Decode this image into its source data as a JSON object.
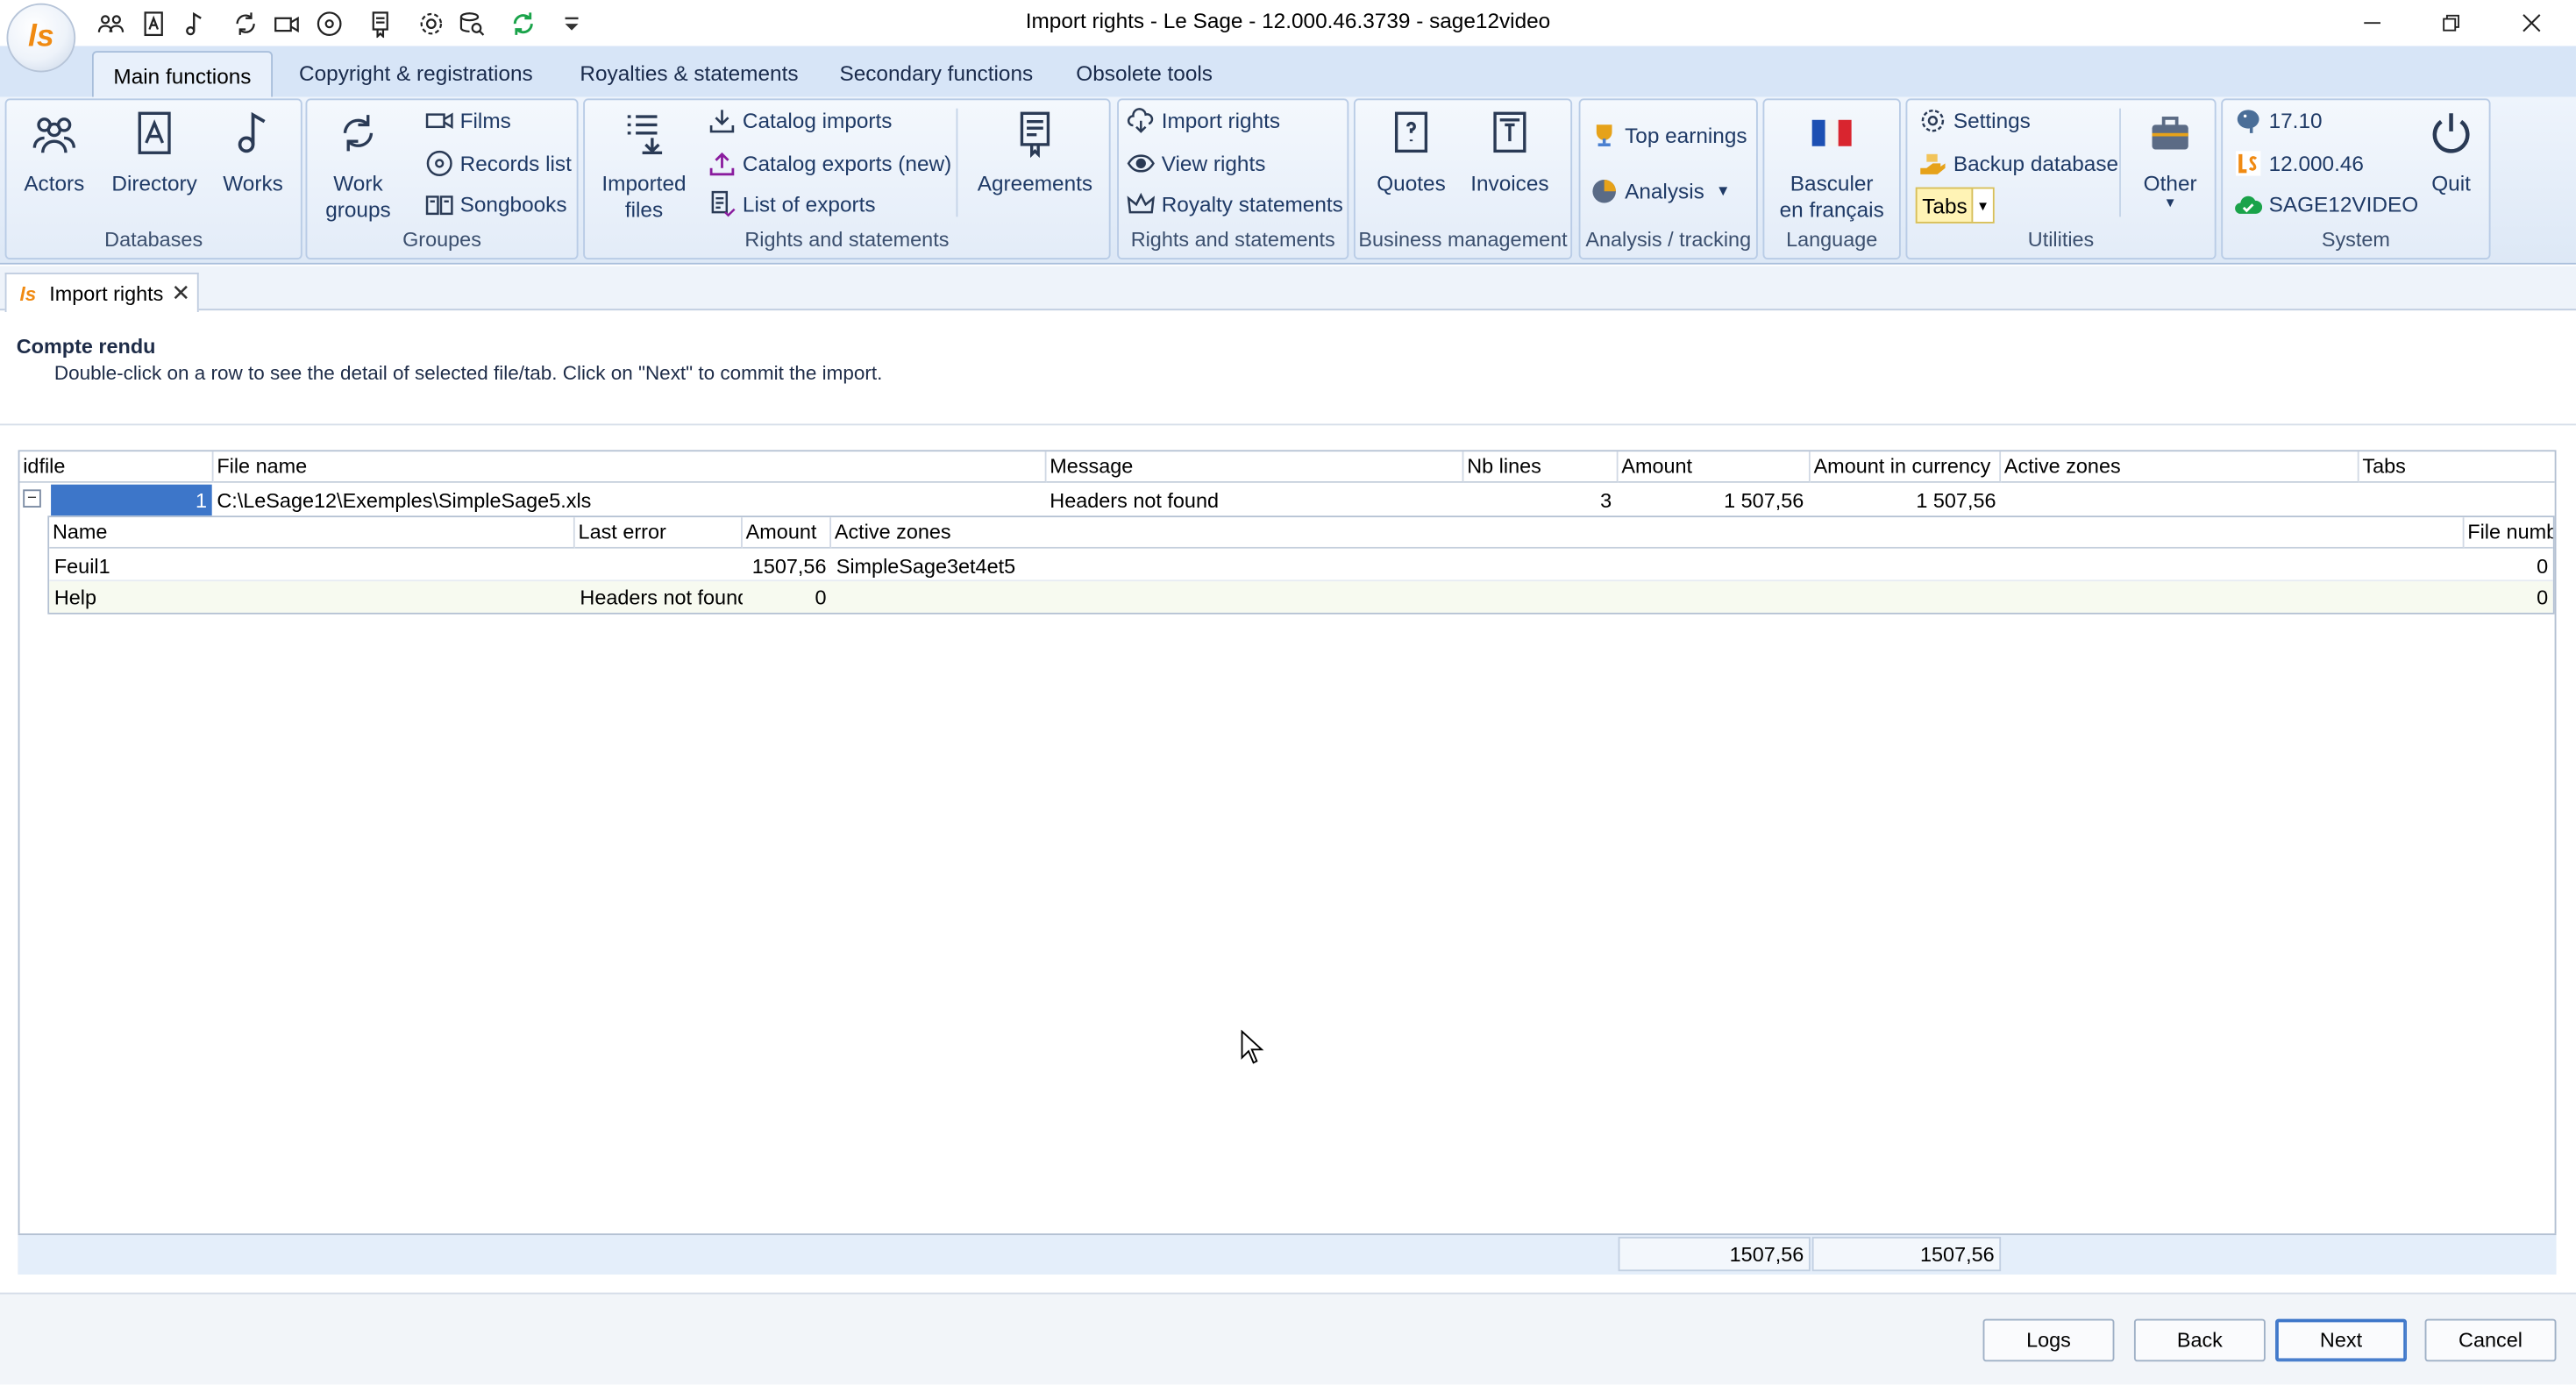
{
  "window": {
    "title": "Import rights - Le Sage - 12.000.46.3739  - sage12video",
    "logo_text": "ls"
  },
  "quick_access": [
    "people-icon",
    "contact-card-icon",
    "music-note-icon",
    "refresh-cycle-icon",
    "video-camera-icon",
    "disc-icon",
    "bookmark-icon",
    "gear-icon",
    "search-database-icon",
    "sync-icon",
    "dropdown-arrow-icon"
  ],
  "ribbon_tabs": [
    "Main functions",
    "Copyright & registrations",
    "Royalties & statements",
    "Secondary functions",
    "Obsolete tools"
  ],
  "ribbon": {
    "databases": {
      "label": "Databases",
      "actors": "Actors",
      "directory": "Directory",
      "works": "Works"
    },
    "groupes": {
      "label": "Groupes",
      "work_groups_1": "Work",
      "work_groups_2": "groups",
      "films": "Films",
      "records_list": "Records list",
      "songbooks": "Songbooks"
    },
    "rights1": {
      "label": "Rights and statements",
      "imported_1": "Imported",
      "imported_2": "files",
      "catalog_imports": "Catalog imports",
      "catalog_exports": "Catalog exports (new)",
      "list_exports": "List of exports",
      "agreements": "Agreements"
    },
    "rights2": {
      "label": "Rights and statements",
      "import_rights": "Import rights",
      "view_rights": "View rights",
      "royalty_statements": "Royalty statements"
    },
    "business": {
      "label": "Business management",
      "quotes": "Quotes",
      "invoices": "Invoices"
    },
    "analysis": {
      "label": "Analysis / tracking",
      "top_earnings": "Top earnings",
      "analysis": "Analysis"
    },
    "language": {
      "label": "Language",
      "basculer_1": "Basculer",
      "basculer_2": "en français"
    },
    "utilities": {
      "label": "Utilities",
      "settings": "Settings",
      "backup": "Backup database",
      "tabs": "Tabs",
      "other": "Other"
    },
    "system": {
      "label": "System",
      "pg_version": "17.10",
      "app_version": "12.000.46",
      "db_name": "SAGE12VIDEO",
      "quit": "Quit"
    }
  },
  "doc_tab": {
    "label": "Import rights"
  },
  "report": {
    "heading": "Compte rendu",
    "instructions": "Double-click on a row to see the detail of selected file/tab. Click on \"Next\" to  commit the import."
  },
  "grid": {
    "columns": [
      "idfile",
      "File name",
      "Message",
      "Nb lines",
      "Amount",
      "Amount in currency",
      "Active zones",
      "Tabs"
    ],
    "row": {
      "idfile": "1",
      "file_name": "C:\\LeSage12\\Exemples\\SimpleSage5.xls",
      "message": "Headers not found",
      "nb_lines": "3",
      "amount": "1 507,56",
      "amount_currency": "1 507,56"
    },
    "detail_columns": [
      "Name",
      "Last error",
      "Amount",
      "Active zones",
      "File numb"
    ],
    "detail_rows": [
      {
        "name": "Feuil1",
        "last_error": "",
        "amount": "1507,56",
        "active_zones": "SimpleSage3et4et5",
        "file_numb": "0"
      },
      {
        "name": "Help",
        "last_error": "Headers not found",
        "amount": "0",
        "active_zones": "",
        "file_numb": "0"
      }
    ],
    "footer": {
      "amount_total": "1507,56",
      "currency_total": "1507,56"
    }
  },
  "buttons": {
    "logs": "Logs",
    "back": "Back",
    "next": "Next",
    "cancel": "Cancel"
  },
  "colors": {
    "ribbon_bg": "#dde8f6",
    "selected_cell": "#3d76c9",
    "accent_orange": "#f08a12"
  }
}
